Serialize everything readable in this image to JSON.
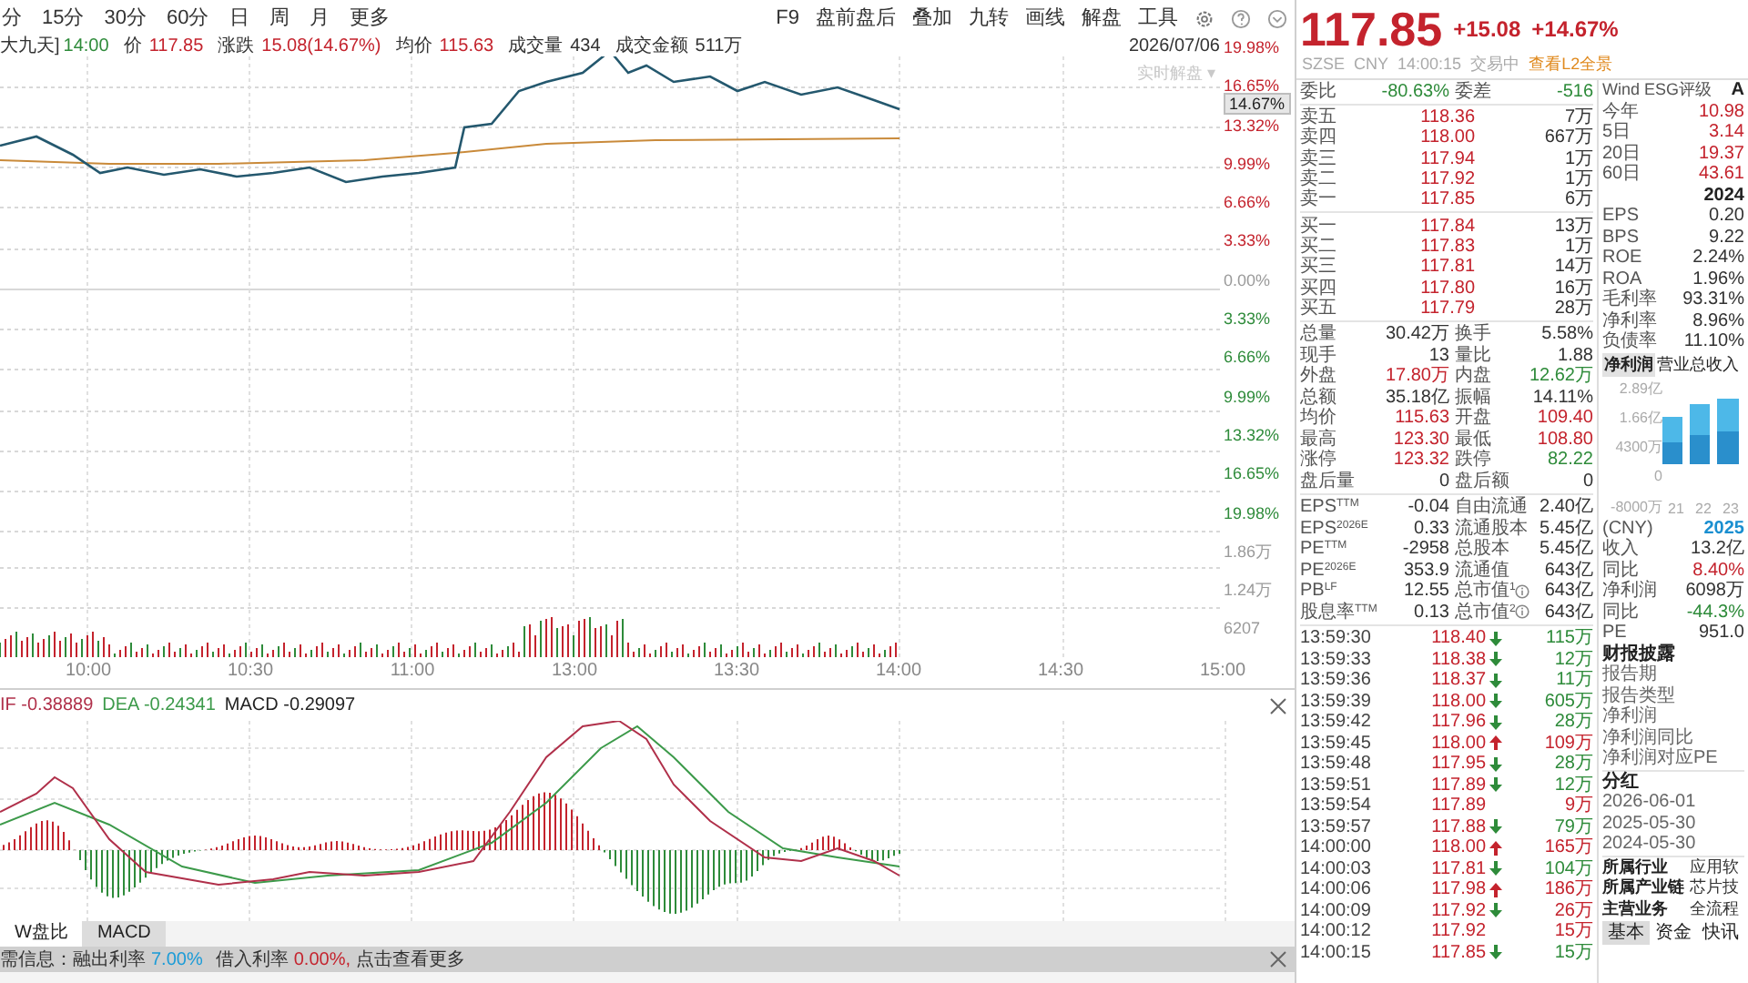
{
  "toolbar": {
    "periods": [
      {
        "label": "分",
        "selected": false
      },
      {
        "label": "15分",
        "selected": false
      },
      {
        "label": "30分",
        "selected": false
      },
      {
        "label": "60分",
        "selected": false
      },
      {
        "label": "日",
        "selected": false
      },
      {
        "label": "周",
        "selected": false
      },
      {
        "label": "月",
        "selected": false
      },
      {
        "label": "更多",
        "selected": false
      }
    ],
    "tools": [
      "F9",
      "盘前盘后",
      "叠加",
      "九转",
      "画线",
      "解盘",
      "工具"
    ]
  },
  "quote_line": {
    "name": "大九天]",
    "time": "14:00",
    "items": [
      {
        "label": "价",
        "value": "117.85",
        "color": "#c4232d"
      },
      {
        "label": "涨跌",
        "value": "15.08(14.67%)",
        "color": "#c4232d"
      },
      {
        "label": "均价",
        "value": "115.63",
        "color": "#c4232d"
      },
      {
        "label": "成交量",
        "value": "434",
        "color": "#333333"
      },
      {
        "label": "成交金额",
        "value": "511万",
        "color": "#333333"
      }
    ],
    "date": "2026/07/06"
  },
  "chart": {
    "realtime_label": "实时解盘 ▾",
    "price_badge": "14.67%",
    "axis_labels": [
      {
        "text": "19.98%",
        "color": "#c4232d"
      },
      {
        "text": "16.65%",
        "color": "#c4232d"
      },
      {
        "text": "13.32%",
        "color": "#c4232d"
      },
      {
        "text": "9.99%",
        "color": "#c4232d"
      },
      {
        "text": "6.66%",
        "color": "#c4232d"
      },
      {
        "text": "3.33%",
        "color": "#c4232d"
      },
      {
        "text": "0.00%",
        "color": "#9a9a9a"
      },
      {
        "text": "3.33%",
        "color": "#2e8b3a"
      },
      {
        "text": "6.66%",
        "color": "#2e8b3a"
      },
      {
        "text": "9.99%",
        "color": "#2e8b3a"
      },
      {
        "text": "13.32%",
        "color": "#2e8b3a"
      },
      {
        "text": "16.65%",
        "color": "#2e8b3a"
      },
      {
        "text": "19.98%",
        "color": "#2e8b3a"
      },
      {
        "text": "1.86万",
        "color": "#9a9a9a"
      },
      {
        "text": "1.24万",
        "color": "#9a9a9a"
      },
      {
        "text": "6207",
        "color": "#9a9a9a"
      }
    ],
    "time_labels": [
      "10:00",
      "10:30",
      "11:00",
      "13:00",
      "13:30",
      "14:00",
      "14:30",
      "15:00"
    ]
  },
  "macd": {
    "dif": "IF -0.38889",
    "dea": "DEA -0.24341",
    "macd": "MACD -0.29097"
  },
  "indicator_tabs": [
    {
      "label": "W盘比",
      "selected": false
    },
    {
      "label": "MACD",
      "selected": true
    }
  ],
  "info_bar": {
    "prefix": "需信息：融出利率",
    "lend_rate": "7.00%",
    "borrow_label": "借入利率",
    "borrow_rate": "0.00%,",
    "suffix": "点击查看更多"
  },
  "quote": {
    "price": "117.85",
    "change": "+15.08",
    "pct": "+14.67%",
    "exchange": "SZSE",
    "currency": "CNY",
    "time": "14:00:15",
    "status": "交易中",
    "l2_link": "查看L2全景"
  },
  "order_ratio": {
    "left": {
      "label": "委比",
      "value": "-80.63%",
      "color": "#2e8b3a"
    },
    "right": {
      "label": "委差",
      "value": "-516",
      "color": "#2e8b3a"
    }
  },
  "asks": [
    {
      "label": "卖五",
      "price": "118.36",
      "volume": "7万"
    },
    {
      "label": "卖四",
      "price": "118.00",
      "volume": "667万"
    },
    {
      "label": "卖三",
      "price": "117.94",
      "volume": "1万"
    },
    {
      "label": "卖二",
      "price": "117.92",
      "volume": "1万"
    },
    {
      "label": "卖一",
      "price": "117.85",
      "volume": "6万"
    }
  ],
  "bids": [
    {
      "label": "买一",
      "price": "117.84",
      "volume": "13万"
    },
    {
      "label": "买二",
      "price": "117.83",
      "volume": "1万"
    },
    {
      "label": "买三",
      "price": "117.81",
      "volume": "14万"
    },
    {
      "label": "买四",
      "price": "117.80",
      "volume": "16万"
    },
    {
      "label": "买五",
      "price": "117.79",
      "volume": "28万"
    }
  ],
  "stats": [
    {
      "left": {
        "label": "总量",
        "value": "30.42万",
        "color": "#333333"
      },
      "right": {
        "label": "换手",
        "value": "5.58%",
        "color": "#333333"
      }
    },
    {
      "left": {
        "label": "现手",
        "value": "13",
        "color": "#333333"
      },
      "right": {
        "label": "量比",
        "value": "1.88",
        "color": "#333333"
      }
    },
    {
      "left": {
        "label": "外盘",
        "value": "17.80万",
        "color": "#c4232d"
      },
      "right": {
        "label": "内盘",
        "value": "12.62万",
        "color": "#2e8b3a"
      }
    },
    {
      "left": {
        "label": "总额",
        "value": "35.18亿",
        "color": "#333333"
      },
      "right": {
        "label": "振幅",
        "value": "14.11%",
        "color": "#333333"
      }
    },
    {
      "left": {
        "label": "均价",
        "value": "115.63",
        "color": "#c4232d"
      },
      "right": {
        "label": "开盘",
        "value": "109.40",
        "color": "#c4232d"
      }
    },
    {
      "left": {
        "label": "最高",
        "value": "123.30",
        "color": "#c4232d"
      },
      "right": {
        "label": "最低",
        "value": "108.80",
        "color": "#c4232d"
      }
    },
    {
      "left": {
        "label": "涨停",
        "value": "123.32",
        "color": "#c4232d"
      },
      "right": {
        "label": "跌停",
        "value": "82.22",
        "color": "#2e8b3a"
      }
    },
    {
      "left": {
        "label": "盘后量",
        "value": "0",
        "color": "#333333"
      },
      "right": {
        "label": "盘后额",
        "value": "0",
        "color": "#333333"
      }
    }
  ],
  "metrics": [
    {
      "l1": "EPS$^{TTM}$",
      "v1": "-0.04",
      "l2": "自由流通",
      "v2": "2.40亿",
      "info": false
    },
    {
      "l1": "EPS$^{2026E}$",
      "v1": "0.33",
      "l2": "流通股本",
      "v2": "5.45亿",
      "info": false
    },
    {
      "l1": "PE$^{TTM}$",
      "v1": "-2958",
      "l2": "总股本",
      "v2": "5.45亿",
      "info": false
    },
    {
      "l1": "PE$^{2026E}$",
      "v1": "353.9",
      "l2": "流通值",
      "v2": "643亿",
      "info": false
    },
    {
      "l1": "PB$^{LF}$",
      "v1": "12.55",
      "l2": "总市值$^{1}$",
      "v2": "643亿",
      "info": true
    },
    {
      "l1": "股息率$^{TTM}$",
      "v1": "0.13",
      "l2": "总市值$^{2}$",
      "v2": "643亿",
      "info": true
    }
  ],
  "ticks": [
    {
      "time": "13:59:30",
      "price": "118.40",
      "kind": "down",
      "volume": "115万",
      "color": "#2e8b3a"
    },
    {
      "time": "13:59:33",
      "price": "118.38",
      "kind": "down",
      "volume": "12万",
      "color": "#2e8b3a"
    },
    {
      "time": "13:59:36",
      "price": "118.37",
      "kind": "down",
      "volume": "11万",
      "color": "#2e8b3a"
    },
    {
      "time": "13:59:39",
      "price": "118.00",
      "kind": "down",
      "volume": "605万",
      "color": "#2e8b3a"
    },
    {
      "time": "13:59:42",
      "price": "117.96",
      "kind": "down",
      "volume": "28万",
      "color": "#2e8b3a"
    },
    {
      "time": "13:59:45",
      "price": "118.00",
      "kind": "up",
      "volume": "109万",
      "color": "#c4232d"
    },
    {
      "time": "13:59:48",
      "price": "117.95",
      "kind": "down",
      "volume": "28万",
      "color": "#2e8b3a"
    },
    {
      "time": "13:59:51",
      "price": "117.89",
      "kind": "down",
      "volume": "12万",
      "color": "#2e8b3a"
    },
    {
      "time": "13:59:54",
      "price": "117.89",
      "kind": "none",
      "volume": "9万",
      "color": "#c4232d"
    },
    {
      "time": "13:59:57",
      "price": "117.88",
      "kind": "down",
      "volume": "79万",
      "color": "#2e8b3a"
    },
    {
      "time": "14:00:00",
      "price": "118.00",
      "kind": "up",
      "volume": "165万",
      "color": "#c4232d"
    },
    {
      "time": "14:00:03",
      "price": "117.81",
      "kind": "down",
      "volume": "104万",
      "color": "#2e8b3a"
    },
    {
      "time": "14:00:06",
      "price": "117.98",
      "kind": "up",
      "volume": "186万",
      "color": "#c4232d"
    },
    {
      "time": "14:00:09",
      "price": "117.92",
      "kind": "down",
      "volume": "26万",
      "color": "#c4232d"
    },
    {
      "time": "14:00:12",
      "price": "117.92",
      "kind": "none",
      "volume": "15万",
      "color": "#c4232d"
    },
    {
      "time": "14:00:15",
      "price": "117.85",
      "kind": "down",
      "volume": "15万",
      "color": "#2e8b3a"
    }
  ],
  "esg": {
    "label": "Wind ESG评级",
    "value": "A"
  },
  "returns": [
    {
      "label": "今年",
      "value": "10.98"
    },
    {
      "label": "5日",
      "value": "3.14"
    },
    {
      "label": "20日",
      "value": "19.37"
    },
    {
      "label": "60日",
      "value": "43.61"
    }
  ],
  "fin_year": "2024",
  "fin": [
    {
      "label": "EPS",
      "value": "0.20"
    },
    {
      "label": "BPS",
      "value": "9.22"
    },
    {
      "label": "ROE",
      "value": "2.24%"
    },
    {
      "label": "ROA",
      "value": "1.96%"
    },
    {
      "label": "毛利率",
      "value": "93.31%"
    },
    {
      "label": "净利率",
      "value": "8.96%"
    },
    {
      "label": "负债率",
      "value": "11.10%"
    }
  ],
  "profit_tabs": [
    {
      "label": "净利润",
      "selected": true
    },
    {
      "label": "营业总收入",
      "selected": false
    }
  ],
  "profit_chart": {
    "yticks": [
      "2.89亿",
      "1.66亿",
      "4300万",
      "0",
      "-8000万"
    ],
    "xlabels": [
      "21",
      "22",
      "23"
    ]
  },
  "annual": {
    "currency": "(CNY)",
    "year": "2025",
    "rows": [
      {
        "label": "收入",
        "value": "13.2亿",
        "color": "#333333"
      },
      {
        "label": "同比",
        "value": "8.40%",
        "color": "#c4232d"
      },
      {
        "label": "净利润",
        "value": "6098万",
        "color": "#333333"
      },
      {
        "label": "同比",
        "value": "-44.3%",
        "color": "#2e8b3a"
      },
      {
        "label": "PE",
        "value": "951.0",
        "color": "#333333"
      }
    ]
  },
  "report": {
    "title": "财报披露",
    "items": [
      "报告期",
      "报告类型",
      "净利润",
      "净利润同比",
      "净利润对应PE"
    ]
  },
  "dividend": {
    "title": "分红",
    "dates": [
      "2026-06-01",
      "2025-05-30",
      "2024-05-30"
    ]
  },
  "industry": [
    {
      "label": "所属行业",
      "value": "应用软"
    },
    {
      "label": "所属产业链",
      "value": "芯片技"
    },
    {
      "label": "主营业务",
      "value": "全流程"
    }
  ],
  "bottom_tabs": [
    {
      "label": "基本",
      "selected": true
    },
    {
      "label": "资金",
      "selected": false
    },
    {
      "label": "快讯",
      "selected": false
    }
  ]
}
